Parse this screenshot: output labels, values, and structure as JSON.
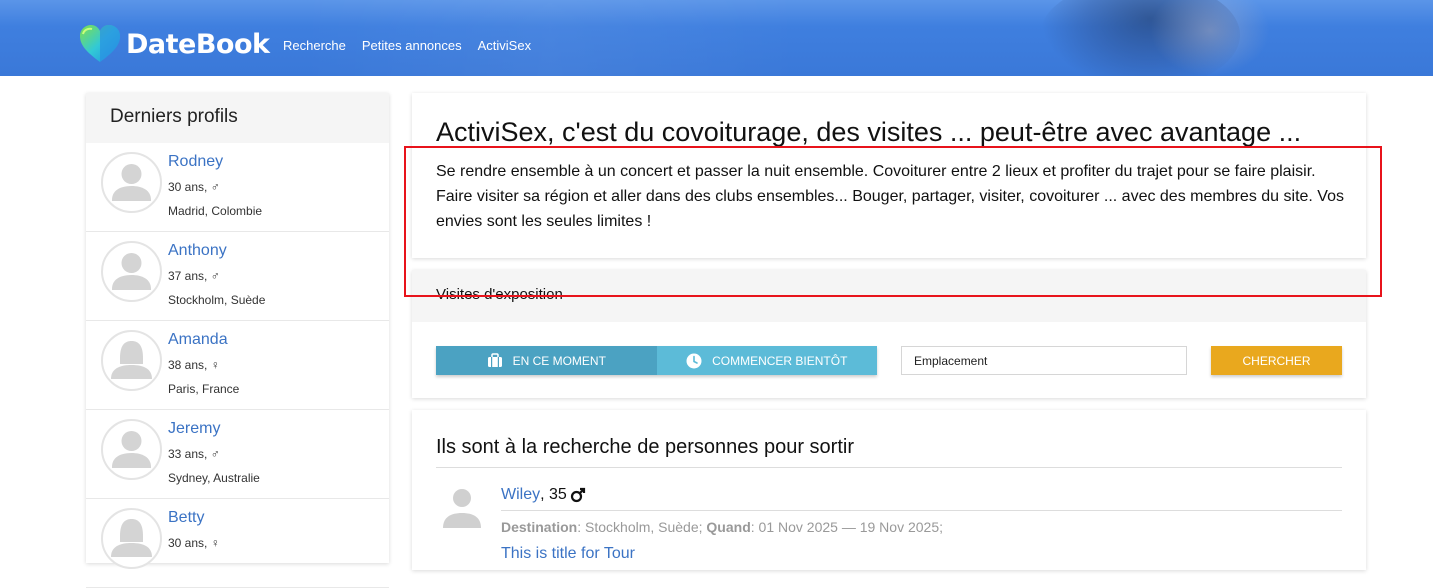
{
  "header": {
    "brand": "DateBook",
    "nav": [
      "Recherche",
      "Petites annonces",
      "ActiviSex"
    ]
  },
  "sidebar": {
    "title": "Derniers profils",
    "profiles": [
      {
        "name": "Rodney",
        "age": "30 ans, ♂",
        "location": "Madrid, Colombie",
        "gender": "male"
      },
      {
        "name": "Anthony",
        "age": "37 ans, ♂",
        "location": "Stockholm, Suède",
        "gender": "male"
      },
      {
        "name": "Amanda",
        "age": "38 ans, ♀",
        "location": "Paris, France",
        "gender": "female"
      },
      {
        "name": "Jeremy",
        "age": "33 ans, ♂",
        "location": "Sydney, Australie",
        "gender": "male"
      },
      {
        "name": "Betty",
        "age": "30 ans, ♀",
        "location": "",
        "gender": "female"
      }
    ]
  },
  "intro": {
    "title": "ActiviSex, c'est du covoiturage, des visites ... peut-être avec avantage ...",
    "text": "Se rendre ensemble à un concert et passer la nuit ensemble. Covoiturer entre 2 lieux et profiter du trajet pour se faire plaisir. Faire visiter sa région et aller dans des clubs ensembles... Bouger, partager, visiter, covoiturer ... avec des membres du site. Vos envies sont les seules limites !"
  },
  "search": {
    "heading": "Visites d'exposition",
    "tab_now": "EN CE MOMENT",
    "tab_soon": "COMMENCER BIENTÔT",
    "location_placeholder": "Emplacement",
    "search_label": "CHERCHER"
  },
  "people": {
    "heading": "Ils sont à la recherche de personnes pour sortir",
    "person": {
      "name": "Wiley",
      "age": ", 35",
      "dest_label": "Destination",
      "dest_value": ": Stockholm, Suède; ",
      "when_label": "Quand",
      "when_value": ": 01 Nov 2025 — 19 Nov 2025;",
      "title_link": "This is title for Tour"
    }
  },
  "colors": {
    "header": "#3f7fdf",
    "link": "#3b73c4",
    "tab_active": "#4ba2c2",
    "tab_inactive": "#5cbbd8",
    "search_button": "#e9a81e",
    "highlight_box": "#e8131b"
  }
}
